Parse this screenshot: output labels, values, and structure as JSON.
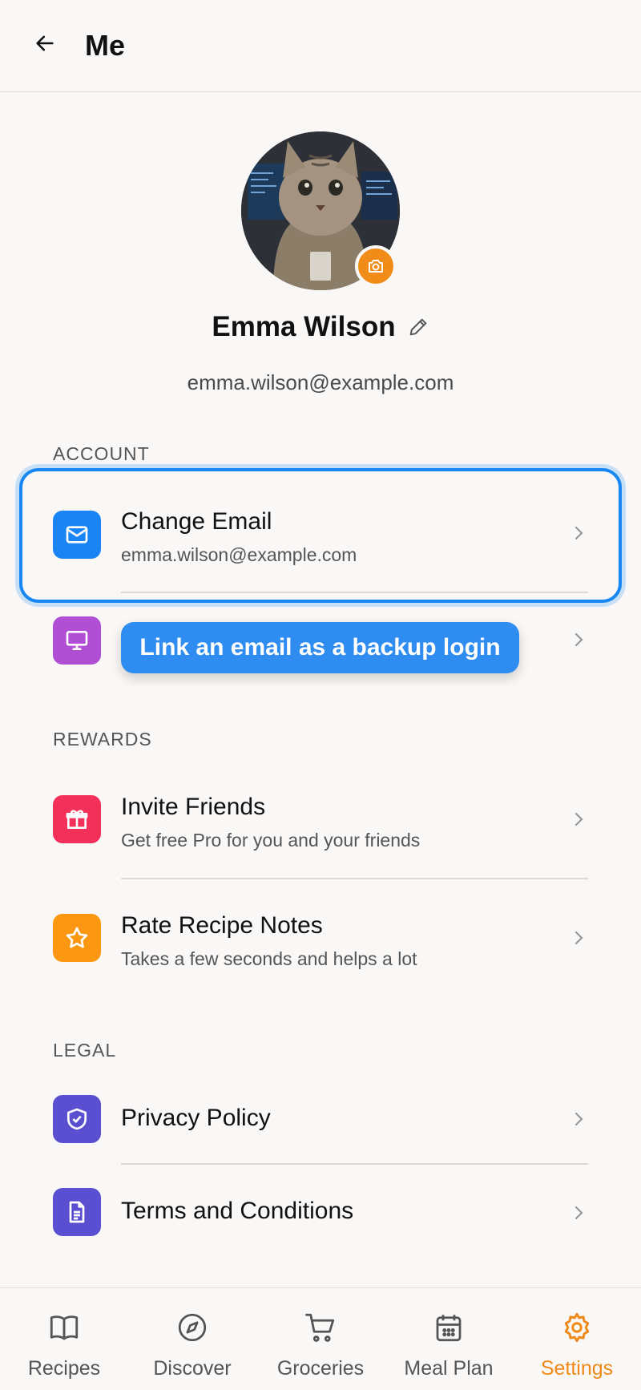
{
  "header": {
    "title": "Me"
  },
  "profile": {
    "name": "Emma Wilson",
    "email": "emma.wilson@example.com"
  },
  "sections": {
    "account": "ACCOUNT",
    "rewards": "REWARDS",
    "legal": "LEGAL"
  },
  "account_items": [
    {
      "title": "Change Email",
      "subtitle": "emma.wilson@example.com",
      "icon": "mail-icon",
      "color": "#1a84f5"
    },
    {
      "title": "",
      "icon": "monitor-icon",
      "color": "#b04fd4"
    }
  ],
  "tooltip": {
    "text": "Link an email as a backup login"
  },
  "rewards_items": [
    {
      "title": "Invite Friends",
      "subtitle": "Get free Pro for you and your friends",
      "icon": "gift-icon",
      "color": "#f2305a"
    },
    {
      "title": "Rate Recipe Notes",
      "subtitle": "Takes a few seconds and helps a lot",
      "icon": "star-icon",
      "color": "#fb9710"
    }
  ],
  "legal_items": [
    {
      "title": "Privacy Policy",
      "icon": "shield-check-icon",
      "color": "#5a4fd1"
    },
    {
      "title": "Terms and Conditions",
      "icon": "document-icon",
      "color": "#5a4fd1"
    }
  ],
  "tabs": [
    {
      "label": "Recipes",
      "icon": "book-icon"
    },
    {
      "label": "Discover",
      "icon": "compass-icon"
    },
    {
      "label": "Groceries",
      "icon": "cart-icon"
    },
    {
      "label": "Meal Plan",
      "icon": "calendar-icon"
    },
    {
      "label": "Settings",
      "icon": "gear-icon",
      "active": true
    }
  ],
  "colors": {
    "accent": "#ef8a1a",
    "highlight": "#1787f2",
    "background": "#faf8f6"
  }
}
